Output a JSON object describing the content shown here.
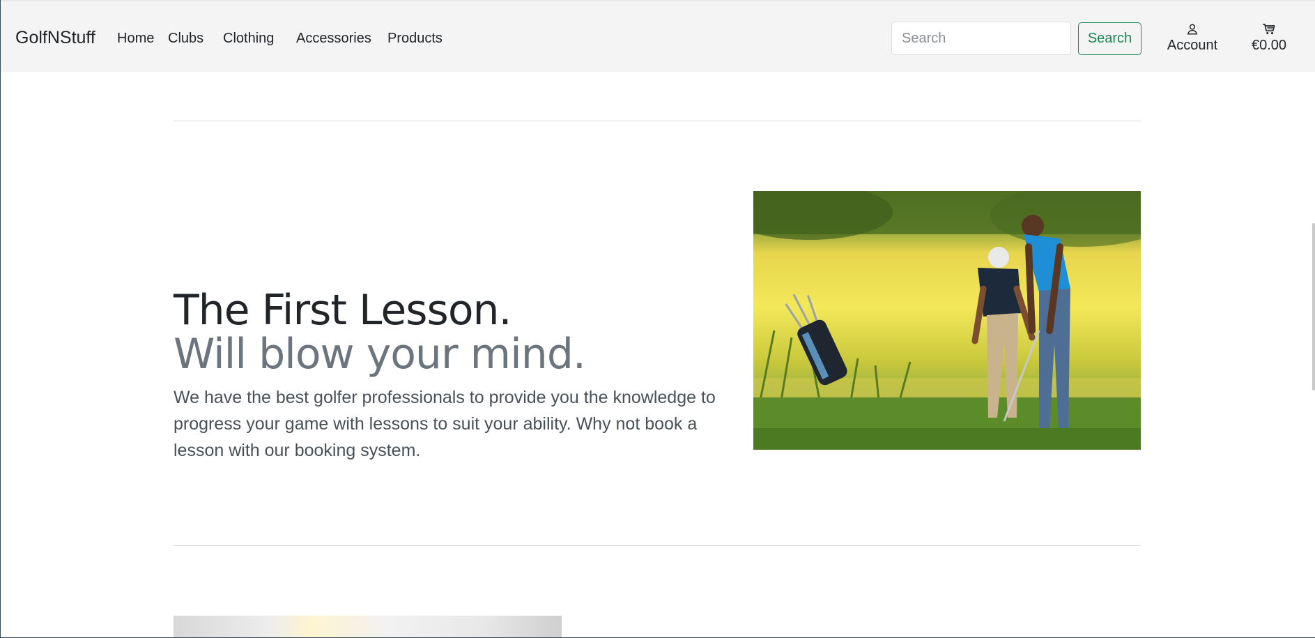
{
  "navbar": {
    "brand": "GolfNStuff",
    "links": [
      "Home",
      "Clubs",
      "Clothing",
      "Accessories",
      "Products"
    ],
    "search": {
      "placeholder": "Search",
      "value": "",
      "button_label": "Search"
    },
    "account_label": "Account",
    "cart_total": "€0.00"
  },
  "lesson": {
    "title": "The First Lesson.",
    "subtitle": "Will blow your mind.",
    "description": "We have the best golfer professionals to provide you the knowledge to progress your game with lessons to suit your ability. Why not book a lesson with our booking system."
  },
  "colors": {
    "navbar_bg": "#f4f4f4",
    "accent_green": "#198754",
    "muted_text": "#6c757d"
  },
  "icons": {
    "account": "person-icon",
    "cart": "cart-icon"
  }
}
